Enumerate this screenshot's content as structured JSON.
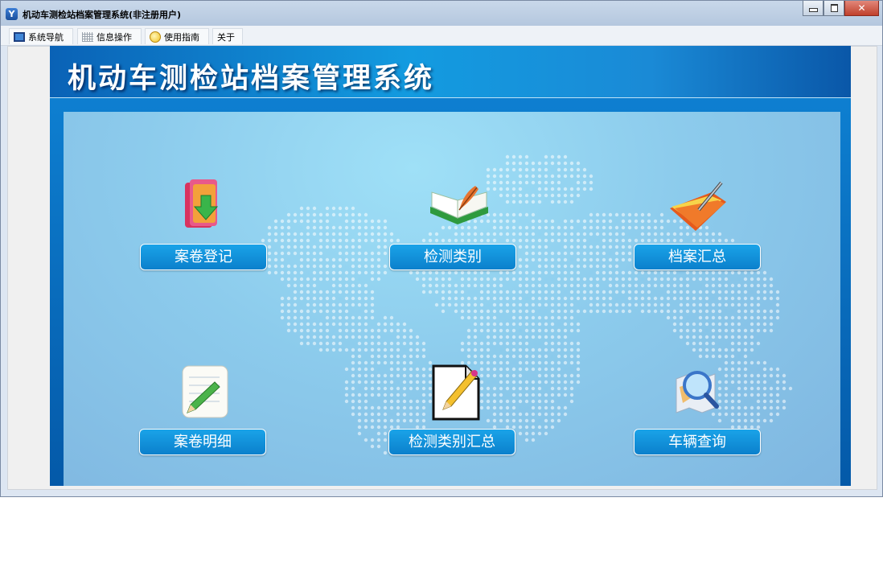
{
  "window": {
    "title": "机动车测检站档案管理系统(非注册用户)",
    "app_icon": "app-logo-icon",
    "controls": [
      "minimize",
      "restore",
      "close"
    ],
    "close_glyph": "✕"
  },
  "menubar": {
    "tabs": [
      {
        "label": "系统导航",
        "icon": "monitor-icon"
      },
      {
        "label": "信息操作",
        "icon": "grid-icon"
      },
      {
        "label": "使用指南",
        "icon": "lightbulb-icon"
      },
      {
        "label": "关于",
        "icon": ""
      }
    ]
  },
  "banner": {
    "title": "机动车测检站档案管理系统"
  },
  "functions": [
    {
      "label": "案卷登记",
      "icon": "folder-download-icon"
    },
    {
      "label": "检测类别",
      "icon": "open-book-quill-icon"
    },
    {
      "label": "档案汇总",
      "icon": "folder-pen-icon"
    },
    {
      "label": "案卷明细",
      "icon": "notepad-pencil-icon"
    },
    {
      "label": "检测类别汇总",
      "icon": "document-pencil-icon"
    },
    {
      "label": "车辆查询",
      "icon": "map-magnifier-icon"
    }
  ],
  "colors": {
    "accent": "#0b80cc",
    "panel": "#0459a8",
    "content_bg": "#8ccbec"
  }
}
